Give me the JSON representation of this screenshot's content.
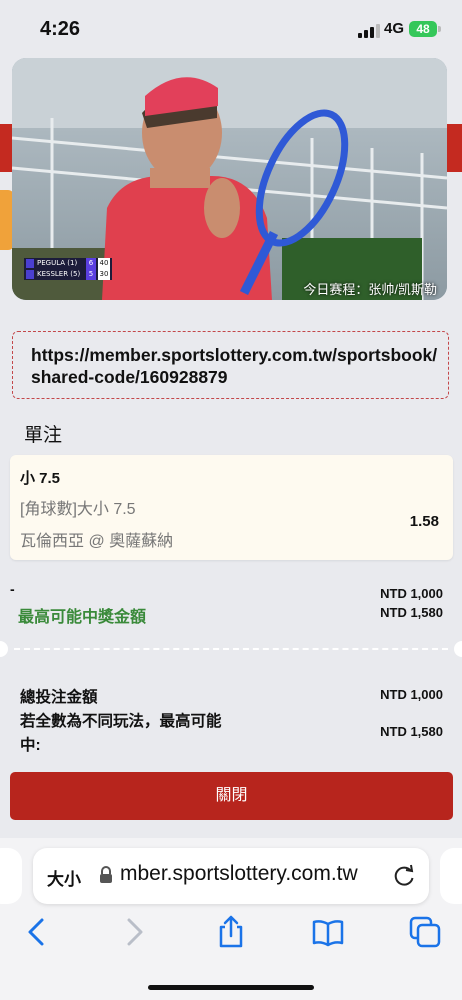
{
  "status_bar": {
    "time": "4:26",
    "network": "4G",
    "battery": "48"
  },
  "video": {
    "caption": "今日赛程：张帅/凯斯勒",
    "scoreboard": [
      {
        "name": "PEGULA (1)",
        "games": "6",
        "points": "40"
      },
      {
        "name": "KESSLER (5)",
        "games": "5",
        "points": "30"
      }
    ]
  },
  "share_url": "https://member.sportslottery.com.tw/sportsbook/shared-code/160928879",
  "bet": {
    "section_title": "單注",
    "selection": "小 7.5",
    "market": "[角球數]大小 7.5",
    "event": "瓦倫西亞 @ 奧薩蘇納",
    "odds": "1.58"
  },
  "summary": {
    "dash": "-",
    "max_win_label": "最高可能中獎金額",
    "stake_value": "NTD 1,000",
    "max_win_value": "NTD 1,580",
    "total_label": "總投注金額",
    "total_value": "NTD 1,000",
    "all_win_label": "若全數為不同玩法，最高可能中:",
    "all_win_value": "NTD 1,580"
  },
  "close_button": "關閉",
  "browser": {
    "aa_label": "大小",
    "address": "mber.sportslottery.com.tw",
    "accent_color": "#1a73e8"
  },
  "colors": {
    "brand_red": "#b7251d",
    "win_green": "#3a8a3a",
    "dashed_border": "#c3474a"
  }
}
